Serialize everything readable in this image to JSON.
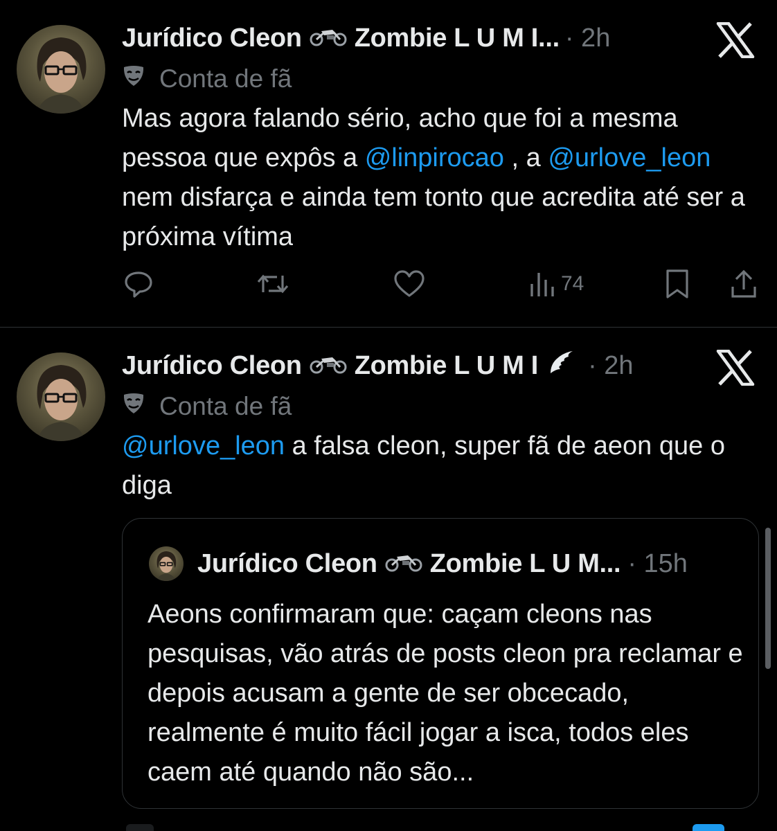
{
  "tweets": [
    {
      "display_name": "Jurídico Cleon",
      "name_suffix": "Zombie L U M I...",
      "time": "· 2h",
      "badge": "Conta de fã",
      "text_parts": [
        "Mas agora falando sério, acho que foi a mesma pessoa que expôs a ",
        "@linpirocao",
        " , a ",
        "@urlove_leon",
        " nem disfarça e ainda tem tonto que acredita até ser a próxima vítima"
      ],
      "views": "74"
    },
    {
      "display_name": "Jurídico Cleon",
      "name_suffix": "Zombie L U M I",
      "time": "· 2h",
      "badge": "Conta de fã",
      "text_parts": [
        "@urlove_leon",
        " a falsa cleon, super fã de aeon que o diga"
      ],
      "quote": {
        "display_name": "Jurídico Cleon",
        "name_suffix": "Zombie L U M...",
        "time": "· 15h",
        "text": "Aeons confirmaram que: caçam cleons nas pesquisas, vão atrás de posts cleon pra reclamar e depois acusam a gente de ser obcecado, realmente é muito fácil jogar a isca, todos eles caem até quando não são..."
      }
    }
  ],
  "colors": {
    "background": "#000000",
    "text": "#e7e9ea",
    "secondary": "#71767b",
    "link": "#1d9bf0",
    "border": "#2f3336"
  },
  "icons": [
    "avatar",
    "motorcycle-icon",
    "x-logo-icon",
    "theater-mask-icon",
    "reply-icon",
    "retweet-icon",
    "like-icon",
    "views-icon",
    "bookmark-icon",
    "share-icon",
    "angel-wing-icon"
  ]
}
